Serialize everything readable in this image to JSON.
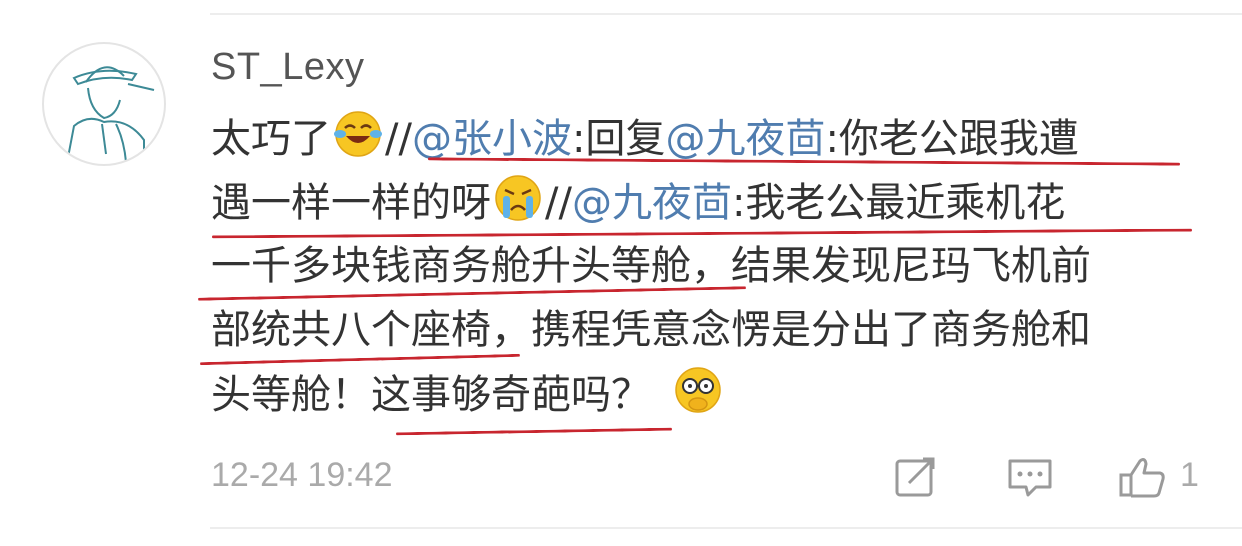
{
  "comment": {
    "username": "ST_Lexy",
    "avatar_icon": "man-in-fedora-sketch-icon",
    "lines": {
      "l1": {
        "a": "太巧了",
        "b": "//",
        "c": "@张小波",
        "d": ":回复",
        "e": "@九夜茴",
        "f": ":你老公跟我遭"
      },
      "l2": {
        "a": "遇一样一样的呀",
        "b": "//",
        "c": "@九夜茴",
        "d": ":我老公最近乘机花"
      },
      "l3": {
        "a": "一千多块钱商务舱升头等舱，结果发现尼玛飞机前"
      },
      "l4": {
        "a": "部统共八个座椅，携程凭意念愣是分出了商务舱和"
      },
      "l5": {
        "a": "头等舱！这事够奇葩吗？"
      }
    },
    "emojis": [
      "laughing-tears-emoji",
      "crying-emoji",
      "glasses-thinking-emoji"
    ],
    "timestamp": "12-24 19:42",
    "actions": {
      "share_icon": "share-edit-icon",
      "reply_icon": "comment-bubble-icon",
      "like_icon": "thumbs-up-icon",
      "like_count": "1"
    },
    "colors": {
      "mention": "#507daf",
      "underline": "#c8262f",
      "meta": "#aaaaaa"
    }
  }
}
